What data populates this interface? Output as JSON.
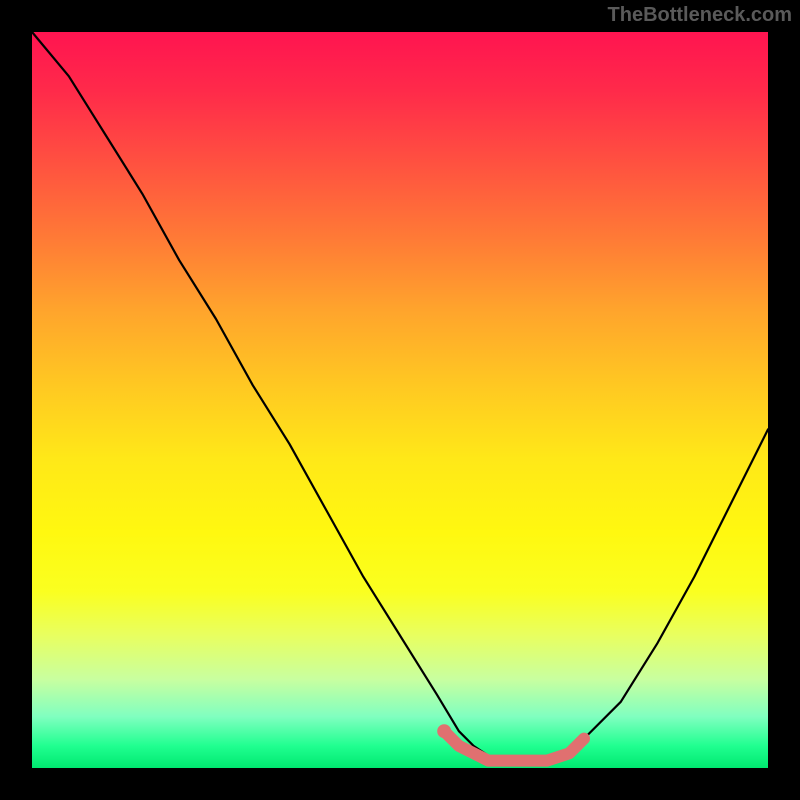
{
  "watermark": "TheBottleneck.com",
  "chart_data": {
    "type": "line",
    "title": "",
    "xlabel": "",
    "ylabel": "",
    "xlim": [
      0,
      100
    ],
    "ylim": [
      0,
      100
    ],
    "series": [
      {
        "name": "bottleneck-curve",
        "x": [
          0,
          5,
          10,
          15,
          20,
          25,
          30,
          35,
          40,
          45,
          50,
          55,
          58,
          60,
          63,
          66,
          70,
          73,
          75,
          80,
          85,
          90,
          95,
          100
        ],
        "values": [
          100,
          94,
          86,
          78,
          69,
          61,
          52,
          44,
          35,
          26,
          18,
          10,
          5,
          3,
          1,
          1,
          1,
          2,
          4,
          9,
          17,
          26,
          36,
          46
        ]
      }
    ],
    "annotations": [
      {
        "name": "min-highlight",
        "x": [
          56,
          58,
          62,
          66,
          70,
          73,
          75
        ],
        "values": [
          5,
          3,
          1,
          1,
          1,
          2,
          4
        ]
      }
    ],
    "colors": {
      "curve": "#000000",
      "highlight": "#e07070",
      "gradient_top": "#ff1450",
      "gradient_bottom": "#00e870",
      "background": "#000000"
    }
  }
}
